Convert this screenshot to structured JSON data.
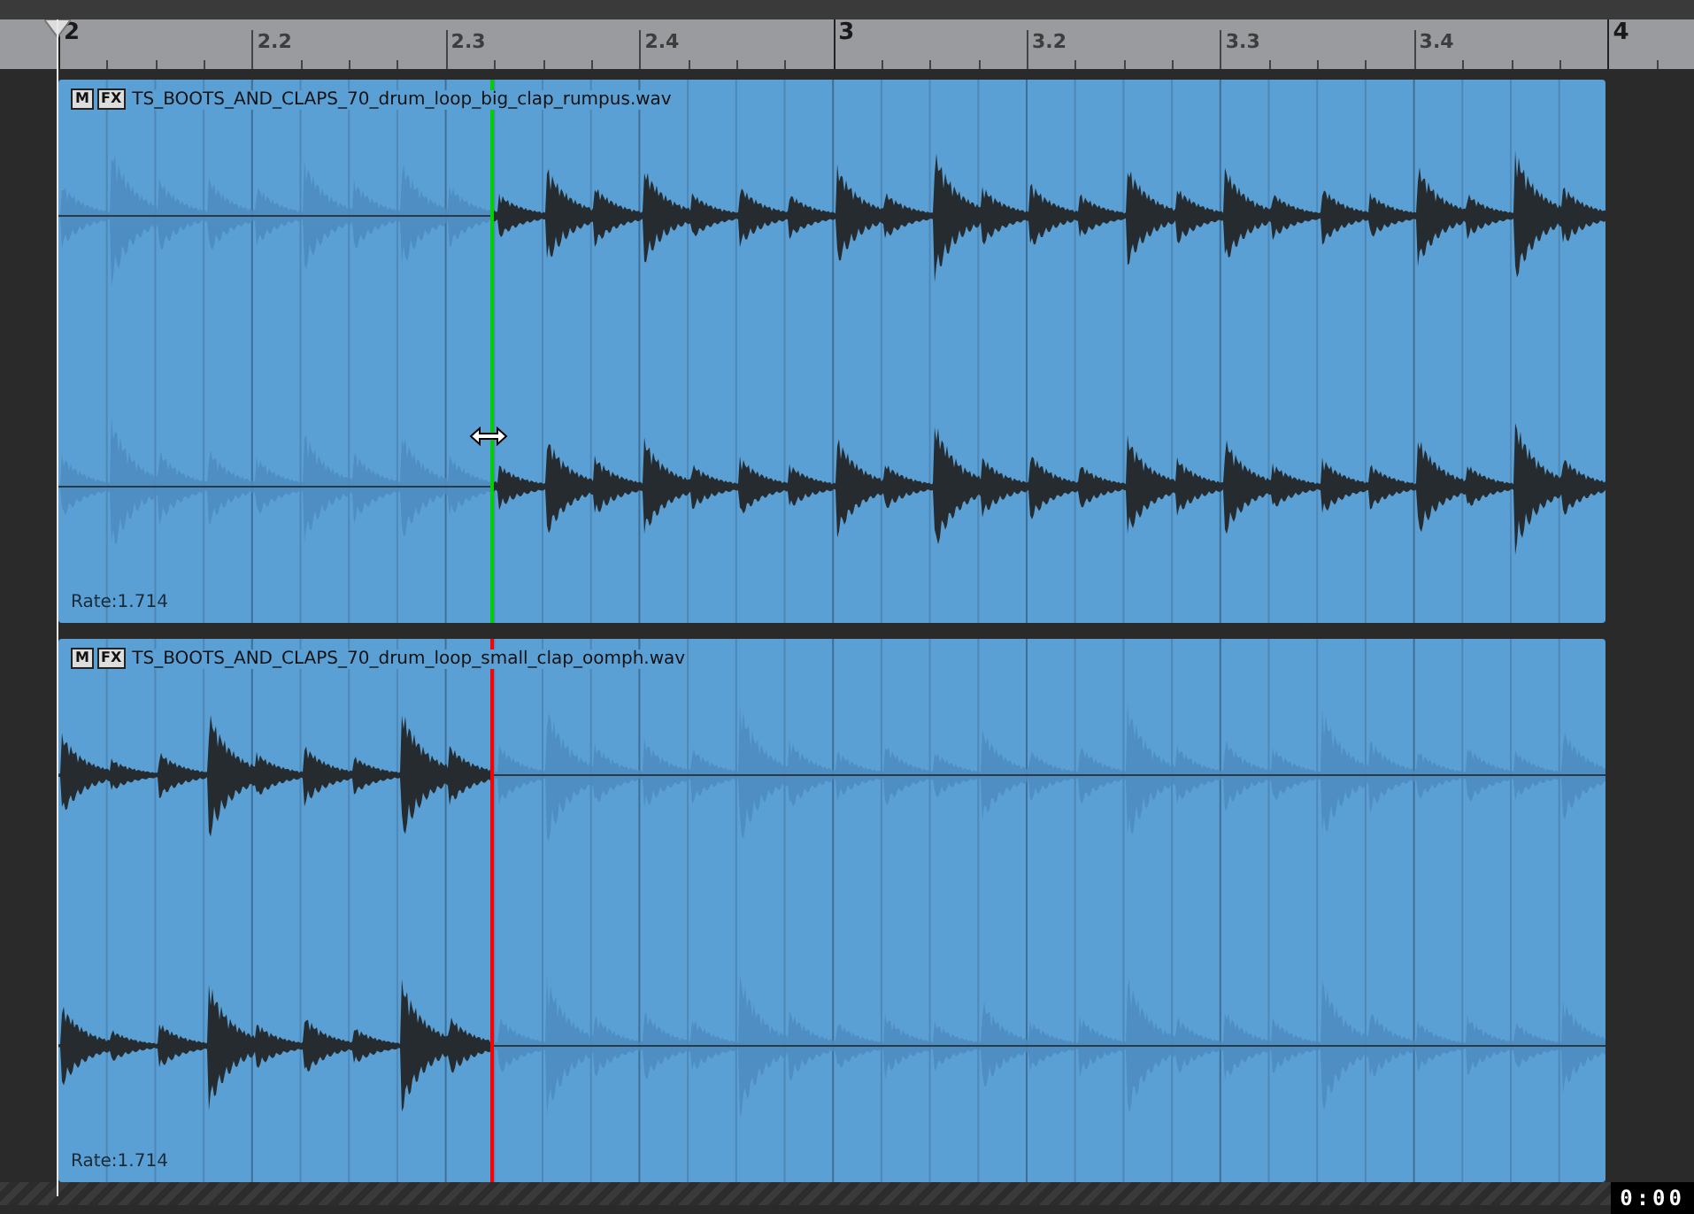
{
  "ruler": {
    "labels": [
      {
        "text": "2",
        "kind": "bar"
      },
      {
        "text": "2.2",
        "kind": "beat"
      },
      {
        "text": "2.3",
        "kind": "beat"
      },
      {
        "text": "2.4",
        "kind": "beat"
      },
      {
        "text": "3",
        "kind": "bar"
      },
      {
        "text": "3.2",
        "kind": "beat"
      },
      {
        "text": "3.3",
        "kind": "beat"
      },
      {
        "text": "3.4",
        "kind": "beat"
      },
      {
        "text": "4",
        "kind": "bar"
      }
    ]
  },
  "clips": [
    {
      "mute_label": "M",
      "fx_label": "FX",
      "name": "TS_BOOTS_AND_CLAPS_70_drum_loop_big_clap_rumpus.wav",
      "rate": "Rate:1.714",
      "color": "#00d000",
      "audible_after_split": true
    },
    {
      "mute_label": "M",
      "fx_label": "FX",
      "name": "TS_BOOTS_AND_CLAPS_70_drum_loop_small_clap_oomph.wav",
      "rate": "Rate:1.714",
      "color": "#ff0000",
      "audible_after_split": false
    }
  ],
  "time_display": "0:00"
}
